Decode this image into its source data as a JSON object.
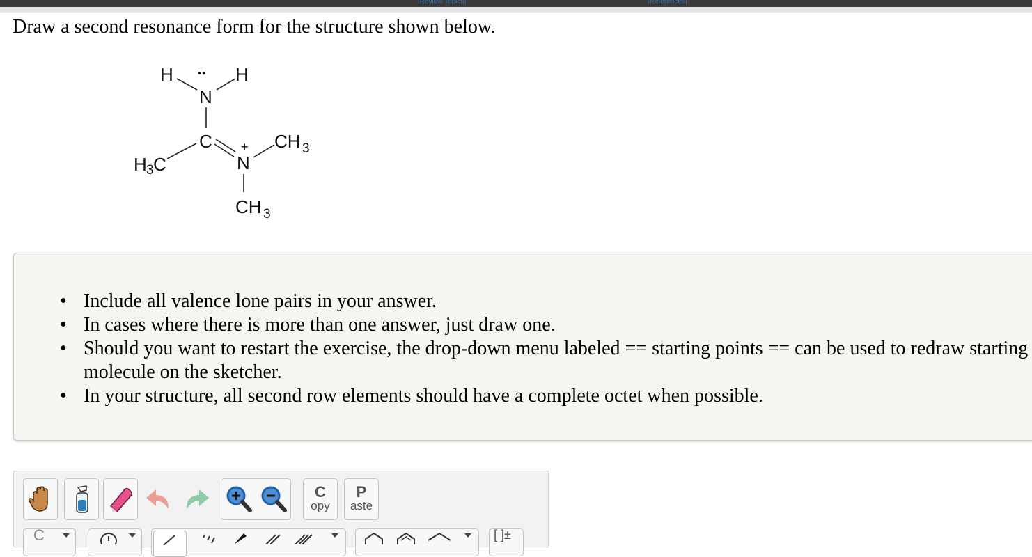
{
  "header": {
    "link_left": "[Review Topics]",
    "link_right": "[References]"
  },
  "question": {
    "prompt": "Draw a second resonance form for the structure shown below."
  },
  "molecule": {
    "atoms": {
      "h_left": "H",
      "h_right": "H",
      "n_top": "N",
      "lone_pair": "••",
      "c_center": "C",
      "n_plus": "N",
      "plus_charge": "+",
      "ch3_left_c": "C",
      "ch3_left_h": "H",
      "ch3_left_sub": "3",
      "ch3_right_ch": "CH",
      "ch3_right_sub": "3",
      "ch3_bottom_ch": "CH",
      "ch3_bottom_sub": "3"
    }
  },
  "instructions": {
    "items": [
      "Include all valence lone pairs in your answer.",
      "In cases where there is more than one answer, just draw one.",
      "Should you want to restart the exercise, the drop-down menu labeled == starting points == can be used to redraw starting molecule on the sketcher.",
      "In your structure, all second row elements should have a complete octet when possible."
    ]
  },
  "toolbar": {
    "copy_big": "C",
    "copy_small": "opy",
    "paste_big": "P",
    "paste_small": "aste",
    "row2_chain": "C",
    "row2_bracket": "[ ]±"
  },
  "colors": {
    "panel_bg": "#f5f6f1",
    "top_bar": "#3a3a3a",
    "hand": "#c8894a",
    "eraser": "#e8508c",
    "undo": "#e88a7c",
    "redo": "#7cc59a",
    "zoom": "#1f5fa8"
  }
}
